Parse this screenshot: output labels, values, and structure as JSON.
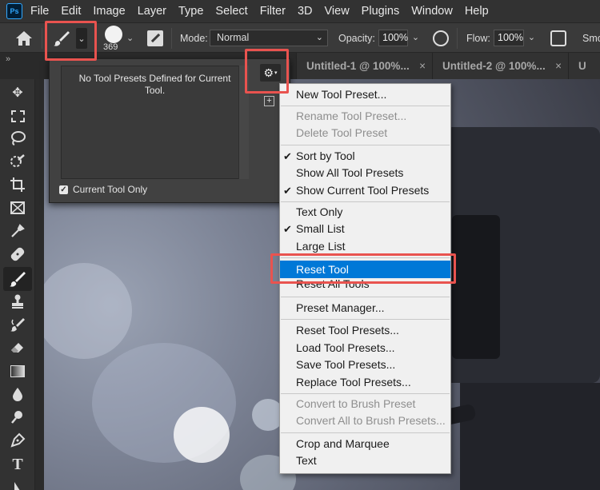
{
  "app": {
    "logo": "Ps"
  },
  "menubar": {
    "items": [
      "File",
      "Edit",
      "Image",
      "Layer",
      "Type",
      "Select",
      "Filter",
      "3D",
      "View",
      "Plugins",
      "Window",
      "Help"
    ]
  },
  "options": {
    "brush_size": "369",
    "mode_label": "Mode:",
    "mode_value": "Normal",
    "opacity_label": "Opacity:",
    "opacity_value": "100%",
    "flow_label": "Flow:",
    "flow_value": "100%",
    "smoothing_label": "Smo"
  },
  "tabs": [
    {
      "label": "Untitled-1 @ 100%...",
      "close": "×"
    },
    {
      "label": "Untitled-2 @ 100%...",
      "close": "×"
    },
    {
      "label": "U"
    }
  ],
  "toolbar_grip": "»",
  "preset_panel": {
    "empty_message": "No Tool Presets Defined for Current Tool.",
    "current_tool_only_label": "Current Tool Only",
    "current_tool_only_checked": true
  },
  "menu": {
    "new_tool_preset": "New Tool Preset...",
    "rename_tool_preset": "Rename Tool Preset...",
    "delete_tool_preset": "Delete Tool Preset",
    "sort_by_tool": "Sort by Tool",
    "show_all_tool_presets": "Show All Tool Presets",
    "show_current_tool_presets": "Show Current Tool Presets",
    "text_only": "Text Only",
    "small_list": "Small List",
    "large_list": "Large List",
    "reset_tool": "Reset Tool",
    "reset_all_tools": "Reset All Tools",
    "preset_manager": "Preset Manager...",
    "reset_tool_presets": "Reset Tool Presets...",
    "load_tool_presets": "Load Tool Presets...",
    "save_tool_presets": "Save Tool Presets...",
    "replace_tool_presets": "Replace Tool Presets...",
    "convert_to_brush_preset": "Convert to Brush Preset",
    "convert_all_to_brush_presets": "Convert All to Brush Presets...",
    "crop_and_marquee": "Crop and Marquee",
    "text": "Text",
    "check_mark": "✔"
  },
  "colors": {
    "highlight": "#0078d7",
    "annotation": "#e9534f",
    "menu_bg": "#f0f0f0",
    "ui_dark": "#323232"
  }
}
